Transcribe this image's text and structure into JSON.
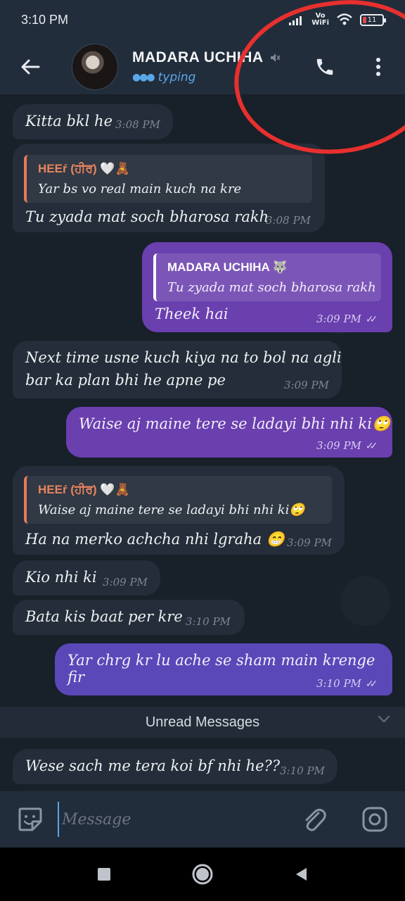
{
  "status_bar": {
    "time": "3:10 PM",
    "network_label": "Vo\nWiFi",
    "battery_level": "11"
  },
  "header": {
    "contact_name": "MADARA UCHIHA",
    "status": "typing"
  },
  "messages": [
    {
      "direction": "in",
      "text": "Kitta bkl he",
      "time": "3:08 PM"
    },
    {
      "direction": "in",
      "reply_to": {
        "name": "HEEŕ (ਹੀਰ) 🤍🧸",
        "text": "Yar bs vo real main kuch na kre"
      },
      "text": "Tu zyada mat soch bharosa rakh",
      "time": "3:08 PM"
    },
    {
      "direction": "out",
      "reply_to": {
        "name": "MADARA UCHIHA 🐺",
        "text": "Tu zyada mat soch bharosa rakh"
      },
      "text": "Theek hai",
      "time": "3:09 PM"
    },
    {
      "direction": "in",
      "text_line1": "Next time usne kuch kiya na to bol na agli",
      "text_line2": "bar ka plan bhi he apne pe",
      "time": "3:09 PM"
    },
    {
      "direction": "out",
      "text": "Waise aj maine tere se ladayi bhi nhi ki🙄",
      "time": "3:09 PM"
    },
    {
      "direction": "in",
      "reply_to": {
        "name": "HEEŕ (ਹੀਰ) 🤍🧸",
        "text": "Waise aj maine tere se ladayi bhi nhi ki🙄"
      },
      "text": "Ha na merko achcha nhi lgraha 😁",
      "time": "3:09 PM"
    },
    {
      "direction": "in",
      "text": "Kio nhi ki",
      "time": "3:09 PM"
    },
    {
      "direction": "in",
      "text": "Bata kis baat per kre",
      "time": "3:10 PM"
    },
    {
      "direction": "out",
      "text": "Yar chrg kr lu ache se sham main krenge fir",
      "time": "3:10 PM"
    },
    {
      "direction": "in",
      "text": "Wese sach me tera koi bf nhi he??",
      "time": "3:10 PM"
    }
  ],
  "unread_label": "Unread Messages",
  "composer": {
    "placeholder": "Message"
  },
  "icons": {
    "back": "arrow-left-icon",
    "mute": "mute-icon",
    "call": "phone-icon",
    "menu": "more-vert-icon",
    "emoji": "sticker-icon",
    "attach": "paperclip-icon",
    "camera": "camera-icon"
  },
  "colors": {
    "outgoing": "#6a3fae",
    "incoming": "#242d39",
    "accent": "#5aa7e8",
    "annotation": "#e8302e"
  }
}
